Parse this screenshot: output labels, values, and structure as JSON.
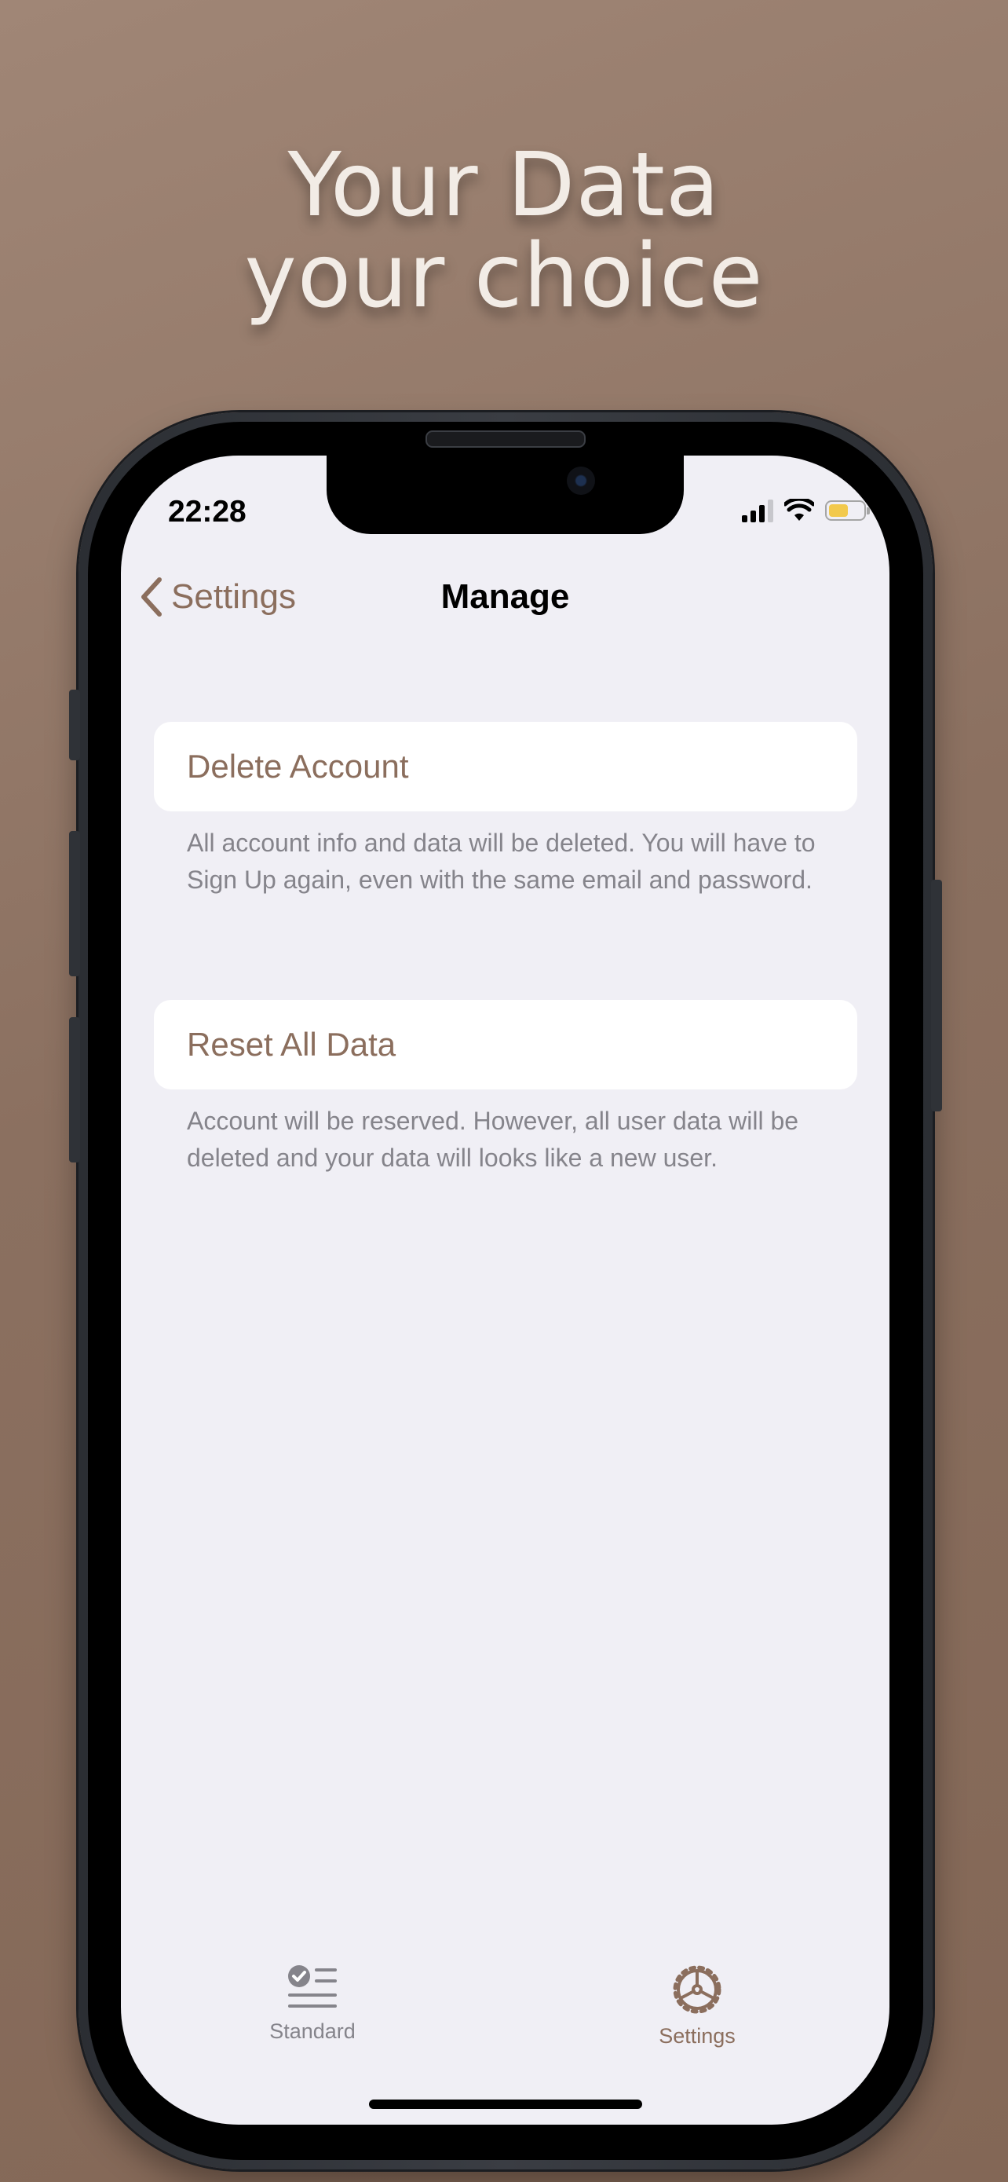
{
  "headline": {
    "line1": "Your Data",
    "line2": "your choice"
  },
  "status_bar": {
    "time": "22:28",
    "battery_color": "#f2c94c"
  },
  "nav": {
    "back_label": "Settings",
    "title": "Manage"
  },
  "options": [
    {
      "label": "Delete Account",
      "note": "All account info and data will be deleted. You will have to Sign Up again, even with the same email and password."
    },
    {
      "label": "Reset All Data",
      "note": "Account will be reserved. However, all user data will be deleted and your data will looks like a new user."
    }
  ],
  "tabs": [
    {
      "label": "Standard",
      "icon": "checklist-icon",
      "active": false
    },
    {
      "label": "Settings",
      "icon": "gear-icon",
      "active": true
    }
  ],
  "colors": {
    "accent": "#8b6e5d",
    "inactive_tab": "#85848b",
    "background": "#8b7060",
    "screen": "#f0eff5"
  }
}
